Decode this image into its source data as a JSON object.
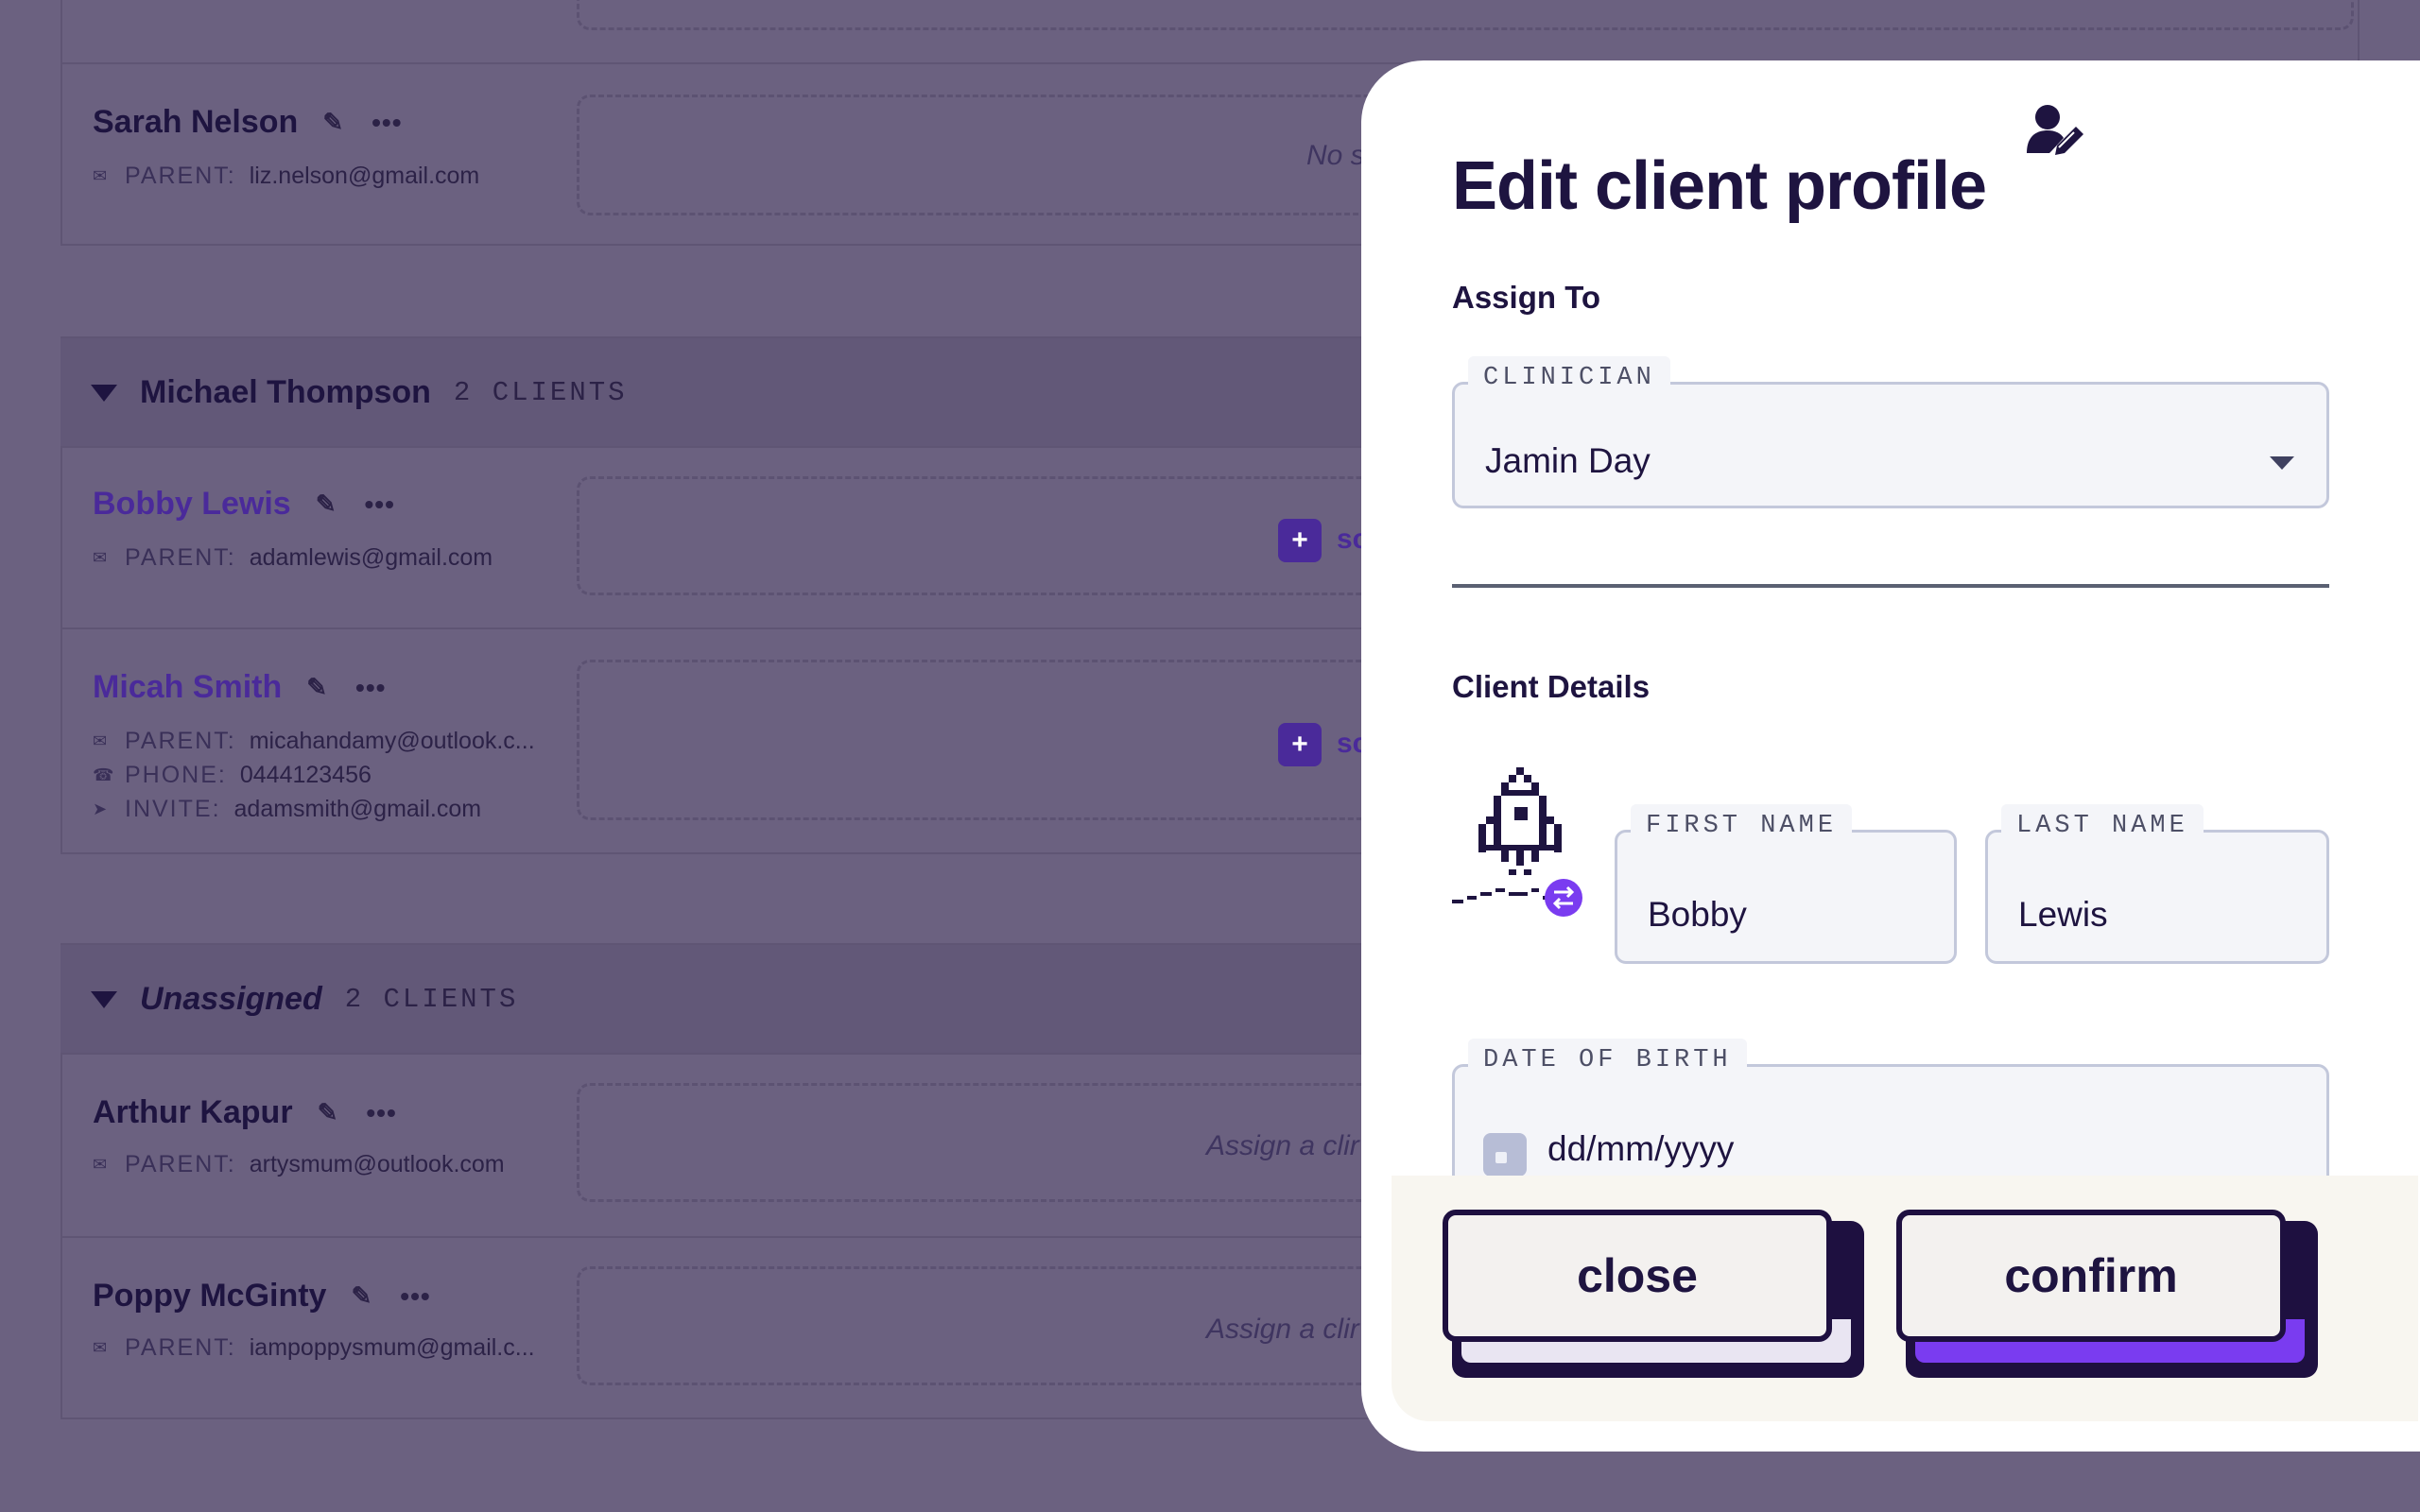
{
  "groups": [
    {
      "name": "Michael Thompson",
      "count": "2 CLIENTS"
    },
    {
      "name": "Unassigned",
      "count": "2 CLIENTS"
    }
  ],
  "clients": [
    {
      "name": "Sarah Nelson",
      "parent_label": "PARENT:",
      "parent_email": "liz.nelson@gmail.com",
      "hint": "No s"
    },
    {
      "name": "Bobby Lewis",
      "parent_label": "PARENT:",
      "parent_email": "adamlewis@gmail.com",
      "sched": "sc"
    },
    {
      "name": "Micah Smith",
      "parent_label": "PARENT:",
      "parent_email": "micahandamy@outlook.c...",
      "phone_label": "PHONE:",
      "phone": "0444123456",
      "invite_label": "INVITE:",
      "invite_email": "adamsmith@gmail.com",
      "sched": "sc"
    },
    {
      "name": "Arthur Kapur",
      "parent_label": "PARENT:",
      "parent_email": "artysmum@outlook.com",
      "hint": "Assign a clir"
    },
    {
      "name": "Poppy McGinty",
      "parent_label": "PARENT:",
      "parent_email": "iampoppysmum@gmail.c...",
      "hint": "Assign a clir"
    }
  ],
  "modal": {
    "title": "Edit client profile",
    "assign_section": "Assign To",
    "clinician_legend": "CLINICIAN",
    "clinician_value": "Jamin Day",
    "details_section": "Client Details",
    "first_name_legend": "FIRST NAME",
    "first_name_value": "Bobby",
    "last_name_legend": "LAST NAME",
    "last_name_value": "Lewis",
    "dob_legend": "DATE OF BIRTH",
    "dob_placeholder": "dd/mm/yyyy",
    "close_label": "close",
    "confirm_label": "confirm"
  },
  "colors": {
    "accent": "#7a3cf0",
    "ink": "#1e1440",
    "overlay": "#6b6180"
  }
}
